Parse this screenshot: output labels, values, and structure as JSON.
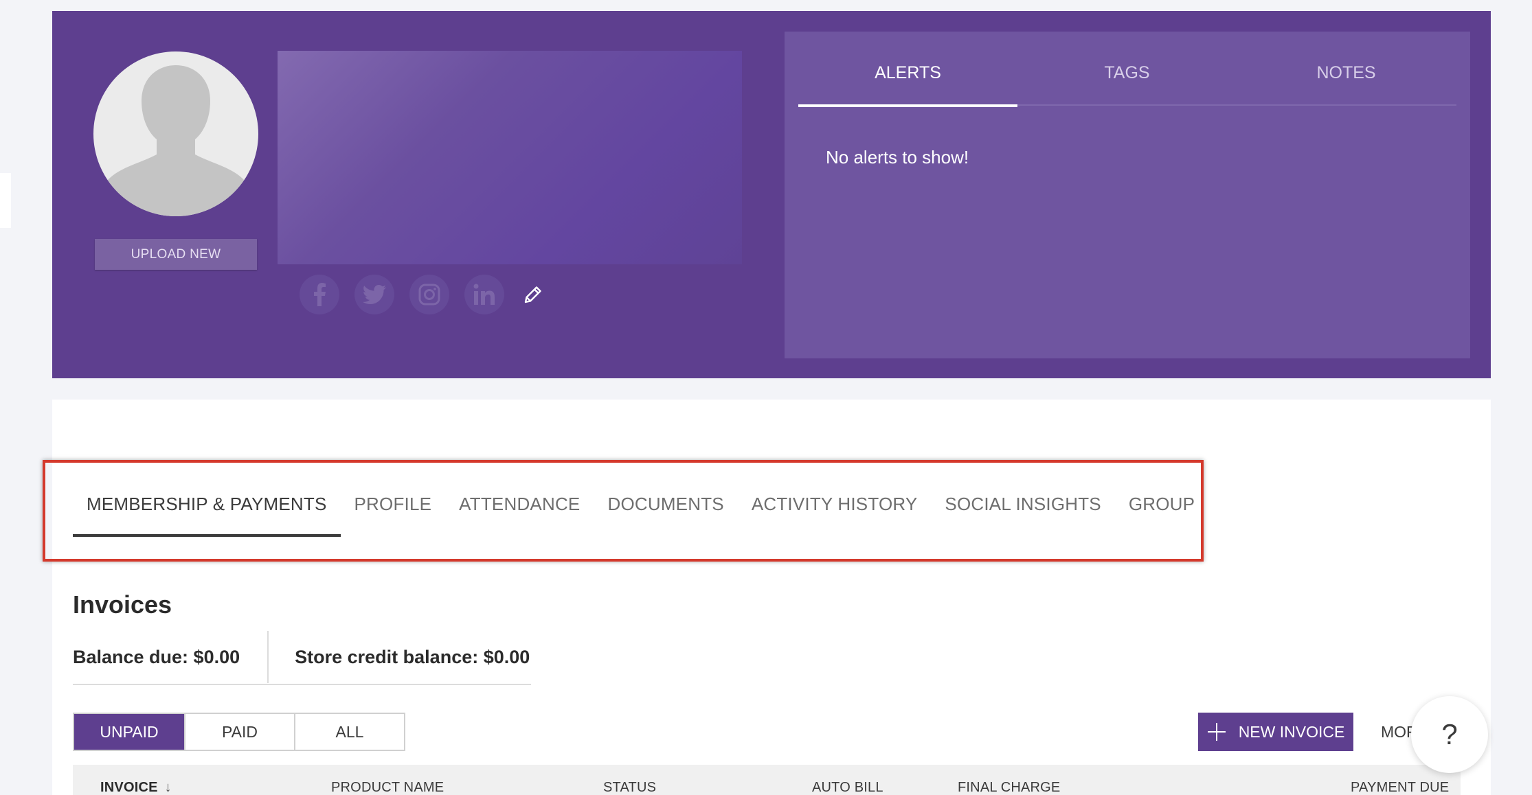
{
  "profile": {
    "upload_label": "UPLOAD NEW",
    "social_icons": [
      "facebook-icon",
      "twitter-icon",
      "instagram-icon",
      "linkedin-icon",
      "pencil-icon"
    ]
  },
  "alerts_panel": {
    "tabs": [
      {
        "label": "ALERTS",
        "active": true
      },
      {
        "label": "TAGS",
        "active": false
      },
      {
        "label": "NOTES",
        "active": false
      }
    ],
    "message": "No alerts to show!"
  },
  "nav": {
    "tabs": [
      {
        "label": "MEMBERSHIP & PAYMENTS",
        "active": true
      },
      {
        "label": "PROFILE",
        "active": false
      },
      {
        "label": "ATTENDANCE",
        "active": false
      },
      {
        "label": "DOCUMENTS",
        "active": false
      },
      {
        "label": "ACTIVITY HISTORY",
        "active": false
      },
      {
        "label": "SOCIAL INSIGHTS",
        "active": false
      },
      {
        "label": "GROUP",
        "active": false
      }
    ]
  },
  "invoices": {
    "title": "Invoices",
    "balance_due": "Balance due: $0.00",
    "store_credit": "Store credit balance: $0.00",
    "filters": [
      {
        "label": "UNPAID",
        "active": true
      },
      {
        "label": "PAID",
        "active": false
      },
      {
        "label": "ALL",
        "active": false
      }
    ],
    "new_invoice_label": "NEW INVOICE",
    "more_label": "MORE",
    "columns": [
      "INVOICE",
      "PRODUCT NAME",
      "STATUS",
      "AUTO BILL",
      "FINAL CHARGE",
      "PAYMENT DUE"
    ]
  },
  "help": {
    "label": "?"
  },
  "colors": {
    "brand_purple": "#5e3f8f",
    "alerts_panel": "#6f55a0",
    "highlight_red": "#d4392c"
  }
}
